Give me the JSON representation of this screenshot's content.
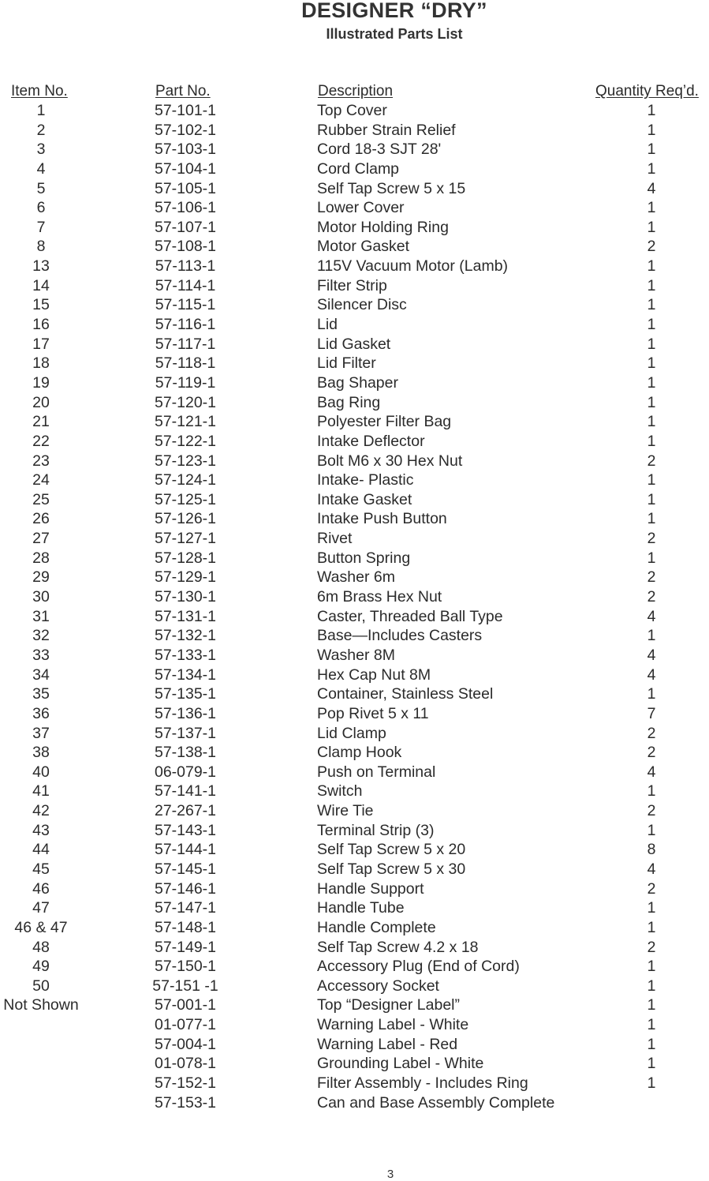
{
  "document": {
    "title": "DESIGNER “DRY”",
    "subtitle": "Illustrated Parts List",
    "page_number": "3"
  },
  "table": {
    "headers": {
      "item": "Item No.",
      "part": "Part No.",
      "description": "Description",
      "quantity": "Quantity Req’d."
    },
    "rows": [
      {
        "item": "1",
        "part": "57-101-1",
        "description": "Top Cover",
        "qty": "1"
      },
      {
        "item": "2",
        "part": "57-102-1",
        "description": "Rubber Strain Relief",
        "qty": "1"
      },
      {
        "item": "3",
        "part": "57-103-1",
        "description": "Cord 18-3 SJT 28'",
        "qty": "1"
      },
      {
        "item": "4",
        "part": "57-104-1",
        "description": "Cord Clamp",
        "qty": "1"
      },
      {
        "item": "5",
        "part": "57-105-1",
        "description": "Self Tap Screw 5 x 15",
        "qty": "4"
      },
      {
        "item": "6",
        "part": "57-106-1",
        "description": "Lower Cover",
        "qty": "1"
      },
      {
        "item": "7",
        "part": "57-107-1",
        "description": "Motor Holding Ring",
        "qty": "1"
      },
      {
        "item": "8",
        "part": "57-108-1",
        "description": "Motor Gasket",
        "qty": "2"
      },
      {
        "item": "13",
        "part": "57-113-1",
        "description": "115V Vacuum Motor (Lamb)",
        "qty": "1"
      },
      {
        "item": "14",
        "part": "57-114-1",
        "description": "Filter Strip",
        "qty": "1"
      },
      {
        "item": "15",
        "part": "57-115-1",
        "description": "Silencer Disc",
        "qty": "1"
      },
      {
        "item": "16",
        "part": "57-116-1",
        "description": "Lid",
        "qty": "1"
      },
      {
        "item": "17",
        "part": "57-117-1",
        "description": "Lid Gasket",
        "qty": "1"
      },
      {
        "item": "18",
        "part": "57-118-1",
        "description": "Lid Filter",
        "qty": "1"
      },
      {
        "item": "19",
        "part": "57-119-1",
        "description": "Bag Shaper",
        "qty": "1"
      },
      {
        "item": "20",
        "part": "57-120-1",
        "description": "Bag Ring",
        "qty": "1"
      },
      {
        "item": "21",
        "part": "57-121-1",
        "description": "Polyester Filter Bag",
        "qty": "1"
      },
      {
        "item": "22",
        "part": "57-122-1",
        "description": "Intake Deflector",
        "qty": "1"
      },
      {
        "item": "23",
        "part": "57-123-1",
        "description": "Bolt M6 x 30 Hex Nut",
        "qty": "2"
      },
      {
        "item": "24",
        "part": "57-124-1",
        "description": "Intake- Plastic",
        "qty": "1"
      },
      {
        "item": "25",
        "part": "57-125-1",
        "description": "Intake Gasket",
        "qty": "1"
      },
      {
        "item": "26",
        "part": "57-126-1",
        "description": "Intake Push Button",
        "qty": "1"
      },
      {
        "item": "27",
        "part": "57-127-1",
        "description": "Rivet",
        "qty": "2"
      },
      {
        "item": "28",
        "part": "57-128-1",
        "description": "Button Spring",
        "qty": "1"
      },
      {
        "item": "29",
        "part": "57-129-1",
        "description": "Washer 6m",
        "qty": "2"
      },
      {
        "item": "30",
        "part": "57-130-1",
        "description": "6m Brass Hex Nut",
        "qty": "2"
      },
      {
        "item": "31",
        "part": "57-131-1",
        "description": "Caster, Threaded Ball Type",
        "qty": "4"
      },
      {
        "item": "32",
        "part": "57-132-1",
        "description": "Base—Includes Casters",
        "qty": "1"
      },
      {
        "item": "33",
        "part": "57-133-1",
        "description": "Washer 8M",
        "qty": "4"
      },
      {
        "item": "34",
        "part": "57-134-1",
        "description": "Hex Cap Nut 8M",
        "qty": "4"
      },
      {
        "item": "35",
        "part": "57-135-1",
        "description": "Container, Stainless Steel",
        "qty": "1"
      },
      {
        "item": "36",
        "part": "57-136-1",
        "description": "Pop Rivet 5 x 11",
        "qty": "7"
      },
      {
        "item": "37",
        "part": "57-137-1",
        "description": "Lid Clamp",
        "qty": "2"
      },
      {
        "item": "38",
        "part": "57-138-1",
        "description": "Clamp Hook",
        "qty": "2"
      },
      {
        "item": "40",
        "part": "06-079-1",
        "description": "Push on Terminal",
        "qty": "4"
      },
      {
        "item": "41",
        "part": "57-141-1",
        "description": "Switch",
        "qty": "1"
      },
      {
        "item": "42",
        "part": "27-267-1",
        "description": "Wire Tie",
        "qty": "2"
      },
      {
        "item": "43",
        "part": "57-143-1",
        "description": "Terminal Strip (3)",
        "qty": "1"
      },
      {
        "item": "44",
        "part": "57-144-1",
        "description": "Self Tap Screw 5 x 20",
        "qty": "8"
      },
      {
        "item": "45",
        "part": "57-145-1",
        "description": "Self Tap Screw 5 x 30",
        "qty": "4"
      },
      {
        "item": "46",
        "part": "57-146-1",
        "description": "Handle Support",
        "qty": "2"
      },
      {
        "item": "47",
        "part": "57-147-1",
        "description": "Handle Tube",
        "qty": "1"
      },
      {
        "item": "46 & 47",
        "part": "57-148-1",
        "description": "Handle Complete",
        "qty": "1"
      },
      {
        "item": "48",
        "part": "57-149-1",
        "description": "Self Tap Screw 4.2 x 18",
        "qty": "2"
      },
      {
        "item": "49",
        "part": "57-150-1",
        "description": "Accessory Plug (End of Cord)",
        "qty": "1"
      },
      {
        "item": "50",
        "part": "57-151 -1",
        "description": "Accessory Socket",
        "qty": "1"
      },
      {
        "item": "Not Shown",
        "part": "57-001-1",
        "description": "Top “Designer Label”",
        "qty": "1"
      },
      {
        "item": "",
        "part": "01-077-1",
        "description": "Warning Label - White",
        "qty": "1"
      },
      {
        "item": "",
        "part": "57-004-1",
        "description": "Warning Label - Red",
        "qty": "1"
      },
      {
        "item": "",
        "part": "01-078-1",
        "description": "Grounding Label - White",
        "qty": "1"
      },
      {
        "item": "",
        "part": "57-152-1",
        "description": "Filter Assembly - Includes Ring",
        "qty": "1"
      },
      {
        "item": "",
        "part": "57-153-1",
        "description": "Can and Base Assembly Complete",
        "qty": ""
      }
    ]
  }
}
